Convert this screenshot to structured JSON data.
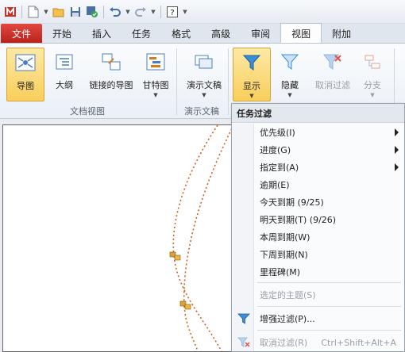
{
  "qat": {
    "icons": [
      "app-logo-icon",
      "new-document-icon",
      "open-folder-icon",
      "save-icon",
      "save-all-icon",
      "undo-icon",
      "redo-icon",
      "help-icon",
      "customize-icon"
    ]
  },
  "tabs": [
    {
      "label": "文件",
      "type": "file"
    },
    {
      "label": "开始"
    },
    {
      "label": "插入"
    },
    {
      "label": "任务"
    },
    {
      "label": "格式"
    },
    {
      "label": "高级"
    },
    {
      "label": "审阅"
    },
    {
      "label": "视图",
      "active": true
    },
    {
      "label": "附加"
    }
  ],
  "ribbon": {
    "map_view": "导图",
    "outline_view": "大纲",
    "linked_map": "链接的导图",
    "gantt": "甘特图",
    "group_doc_view": "文档视图",
    "presentation": "演示文稿",
    "group_presentation": "演示文稿",
    "show": "显示",
    "hide": "隐藏",
    "cancel_filter": "取消过滤",
    "branch": "分支"
  },
  "menu": {
    "header": "任务过滤",
    "items": {
      "priority": "优先级(I)",
      "progress": "进度(G)",
      "assigned": "指定到(A)",
      "overdue": "逾期(E)",
      "today": "今天到期 (9/25)",
      "tomorrow": "明天到期(T) (9/26)",
      "this_week": "本周到期(W)",
      "next_week": "下周到期(N)",
      "milestone": "里程碑(M)",
      "selected_topic": "选定的主题(S)",
      "enhanced_filter": "增强过滤(P)...",
      "cancel_filter": "取消过滤(R)",
      "cancel_shortcut": "Ctrl+Shift+Alt+A"
    }
  },
  "colors": {
    "accent_orange": "#d65f1c",
    "selected_bg": "#f8ce5b",
    "file_tab": "#c8302a",
    "filter_blue": "#3a8fd6"
  }
}
